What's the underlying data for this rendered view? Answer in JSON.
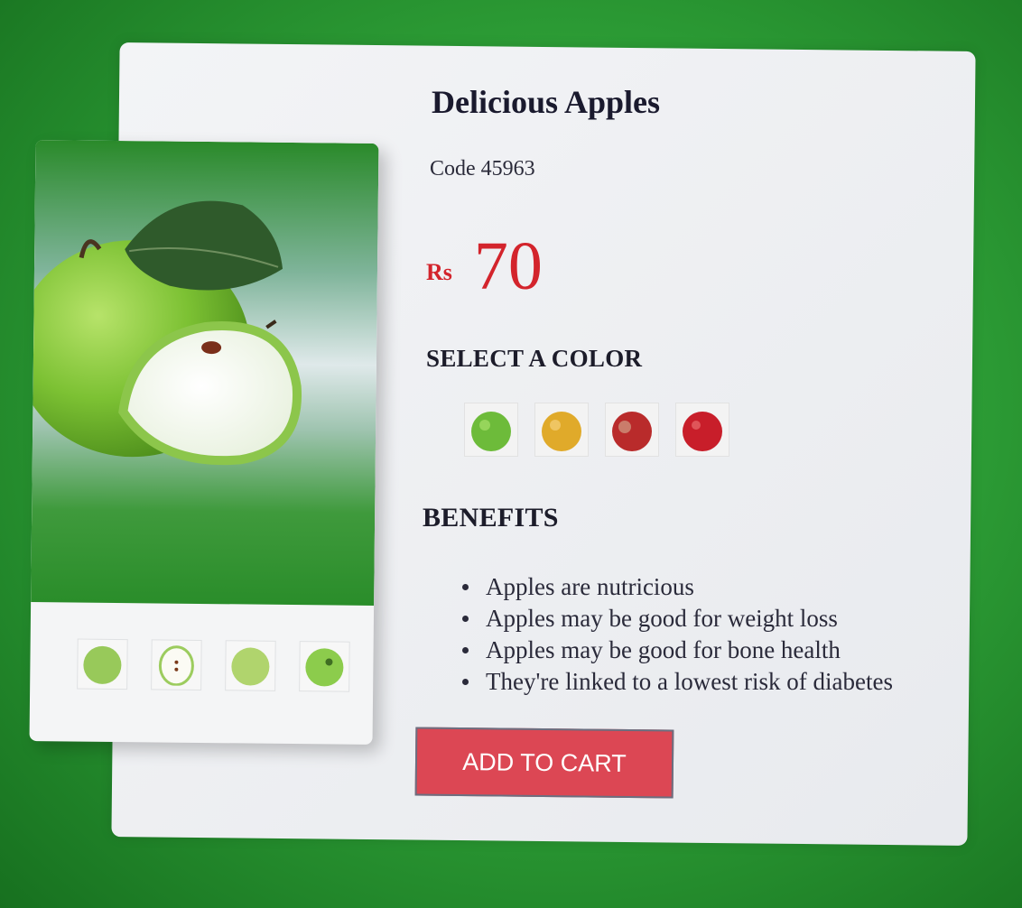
{
  "product": {
    "title": "Delicious Apples",
    "code_label": "Code 45963",
    "currency": "Rs",
    "price": "70"
  },
  "color_section": {
    "heading": "SELECT A COLOR",
    "options": [
      {
        "icon": "green-apple-icon",
        "color": "#6dbb3a"
      },
      {
        "icon": "yellow-apple-icon",
        "color": "#e0aa2a"
      },
      {
        "icon": "red-apple-icon",
        "color": "#b92b2b"
      },
      {
        "icon": "dark-red-apple-icon",
        "color": "#c81e2a"
      }
    ]
  },
  "gallery": {
    "main_image": "green-apple-with-slice-photo",
    "thumbnails": [
      "green-apple-thumb",
      "apple-slice-thumb",
      "green-apple-side-thumb",
      "green-apple-top-thumb"
    ]
  },
  "benefits": {
    "heading": "BENEFITS",
    "items": [
      "Apples are nutricious",
      "Apples may be good for weight loss",
      "Apples may be good for bone health",
      "They're linked to a lowest risk of diabetes"
    ]
  },
  "cart": {
    "button_label": "ADD TO CART",
    "button_color": "#dc4754"
  },
  "theme": {
    "background": "#2fa238",
    "price_color": "#d3242c"
  }
}
